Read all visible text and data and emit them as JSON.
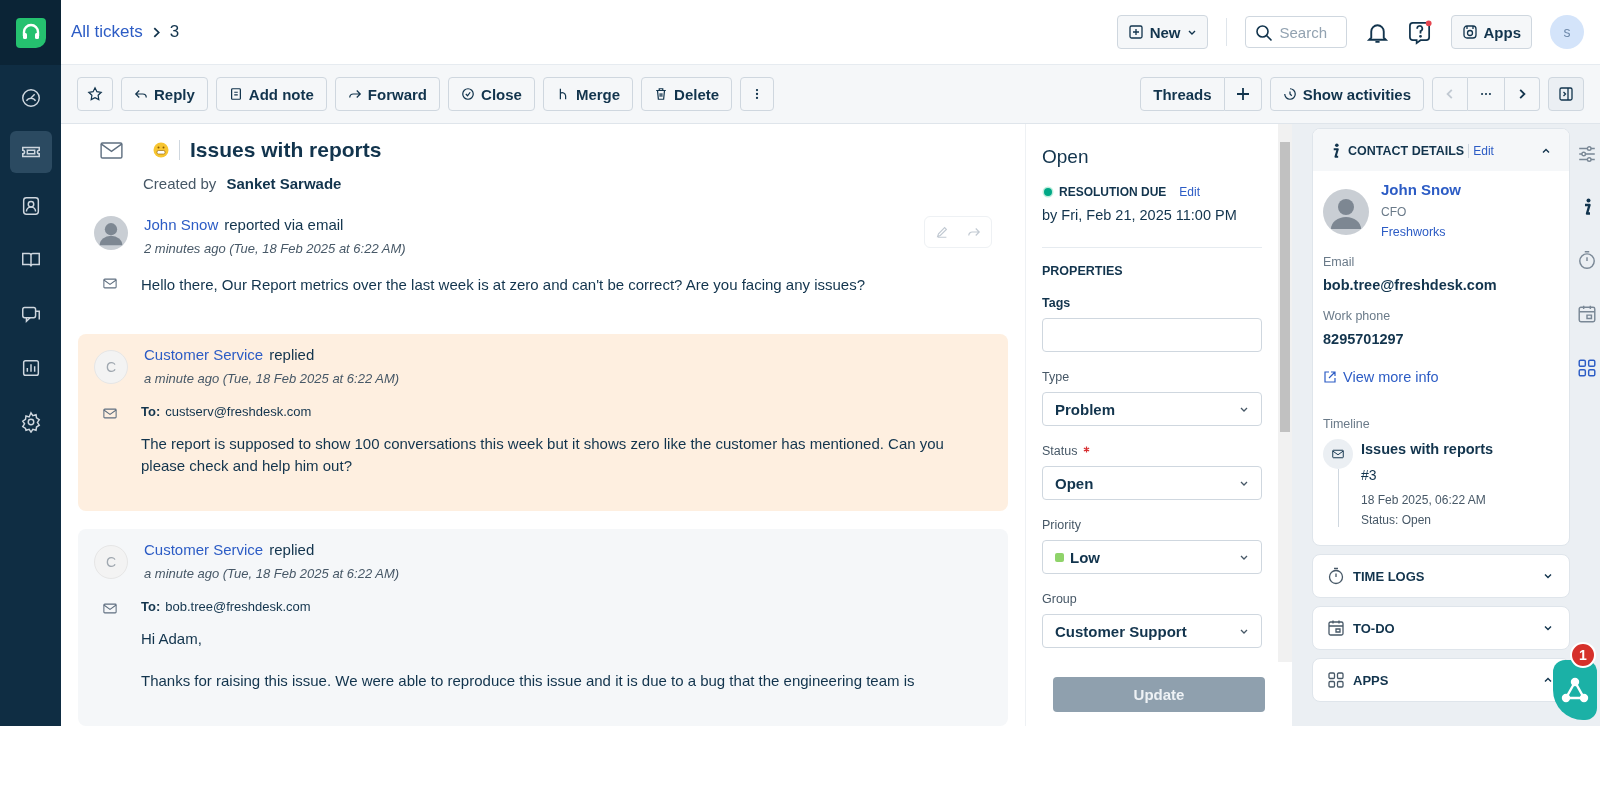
{
  "nav": {
    "items": [
      {
        "kind": "dashboard",
        "selected": false
      },
      {
        "kind": "tickets",
        "selected": true
      },
      {
        "kind": "contacts",
        "selected": false
      },
      {
        "kind": "book",
        "selected": false
      },
      {
        "kind": "chat",
        "selected": false
      },
      {
        "kind": "reports",
        "selected": false
      },
      {
        "kind": "settings",
        "selected": false
      }
    ]
  },
  "breadcrumb": {
    "link": "All tickets",
    "current": "3"
  },
  "header": {
    "new_button": "New",
    "search": {
      "placeholder": "Search"
    },
    "apps_button": "Apps",
    "avatar": "s"
  },
  "toolbar": {
    "actions": [
      {
        "kind": "reply",
        "label": "Reply"
      },
      {
        "kind": "note",
        "label": "Add note"
      },
      {
        "kind": "forward",
        "label": "Forward"
      },
      {
        "kind": "close",
        "label": "Close"
      },
      {
        "kind": "merge",
        "label": "Merge"
      },
      {
        "kind": "delete",
        "label": "Delete"
      }
    ],
    "threads": "Threads",
    "show_activities": "Show activities"
  },
  "ticket": {
    "title": "Issues with reports",
    "created_by_label": "Created by",
    "creator": "Sanket Sarwade"
  },
  "messages": [
    {
      "kind": "incoming",
      "author": "John Snow",
      "action": "reported via email",
      "time": "2 minutes ago (Tue, 18 Feb 2025 at 6:22 AM)",
      "body": [
        "Hello there, Our Report metrics over the last week is at zero and can't be correct? Are you facing any issues?"
      ]
    },
    {
      "kind": "private",
      "author": "Customer Service",
      "action": "replied",
      "initial": "C",
      "time": "a minute ago (Tue, 18 Feb 2025 at 6:22 AM)",
      "to_label": "To:",
      "to": "custserv@freshdesk.com",
      "body": [
        "The report is supposed to show 100 conversations this week but it shows zero like the customer has mentioned. Can you please check and help him out?"
      ]
    },
    {
      "kind": "reply",
      "author": "Customer Service",
      "action": "replied",
      "initial": "C",
      "time": "a minute ago (Tue, 18 Feb 2025 at 6:22 AM)",
      "to_label": "To:",
      "to": "bob.tree@freshdesk.com",
      "body": [
        "Hi Adam,",
        "Thanks for raising this issue. We were able to reproduce this issue and it is due to a bug that the engineering team is"
      ]
    }
  ],
  "properties": {
    "status": "Open",
    "sla": {
      "label": "RESOLUTION DUE",
      "edit": "Edit",
      "due": "by Fri, Feb 21, 2025 11:00 PM"
    },
    "section": "PROPERTIES",
    "fields": [
      {
        "kind": "tags",
        "label": "Tags",
        "required": false
      },
      {
        "kind": "select",
        "label": "Type",
        "required": false,
        "value": "Problem"
      },
      {
        "kind": "select",
        "label": "Status",
        "required": true,
        "value": "Open"
      },
      {
        "kind": "select",
        "label": "Priority",
        "required": false,
        "value": "Low",
        "color": "#8fd36a"
      },
      {
        "kind": "select",
        "label": "Group",
        "required": false,
        "value": "Customer Support"
      }
    ],
    "update_button": "Update"
  },
  "contact": {
    "header": "CONTACT DETAILS",
    "edit": "Edit",
    "expanded": true,
    "name": "John Snow",
    "title": "CFO",
    "company": "Freshworks",
    "email_label": "Email",
    "email": "bob.tree@freshdesk.com",
    "phone_label": "Work phone",
    "phone": "8295701297",
    "view_more": "View more info",
    "timeline_label": "Timeline",
    "timeline": [
      {
        "title": "Issues with reports",
        "number": "#3",
        "date": "18 Feb 2025, 06:22 AM",
        "status": "Status: Open"
      }
    ]
  },
  "panels": [
    {
      "kind": "timer",
      "label": "TIME LOGS",
      "expanded": false
    },
    {
      "kind": "calendar",
      "label": "TO-DO",
      "expanded": false
    },
    {
      "kind": "apps",
      "label": "APPS",
      "expanded": true
    }
  ],
  "rail": [
    {
      "kind": "filters"
    },
    {
      "kind": "info"
    },
    {
      "kind": "timer"
    },
    {
      "kind": "calendar"
    },
    {
      "kind": "apps"
    }
  ],
  "fab": {
    "badge": "1"
  }
}
